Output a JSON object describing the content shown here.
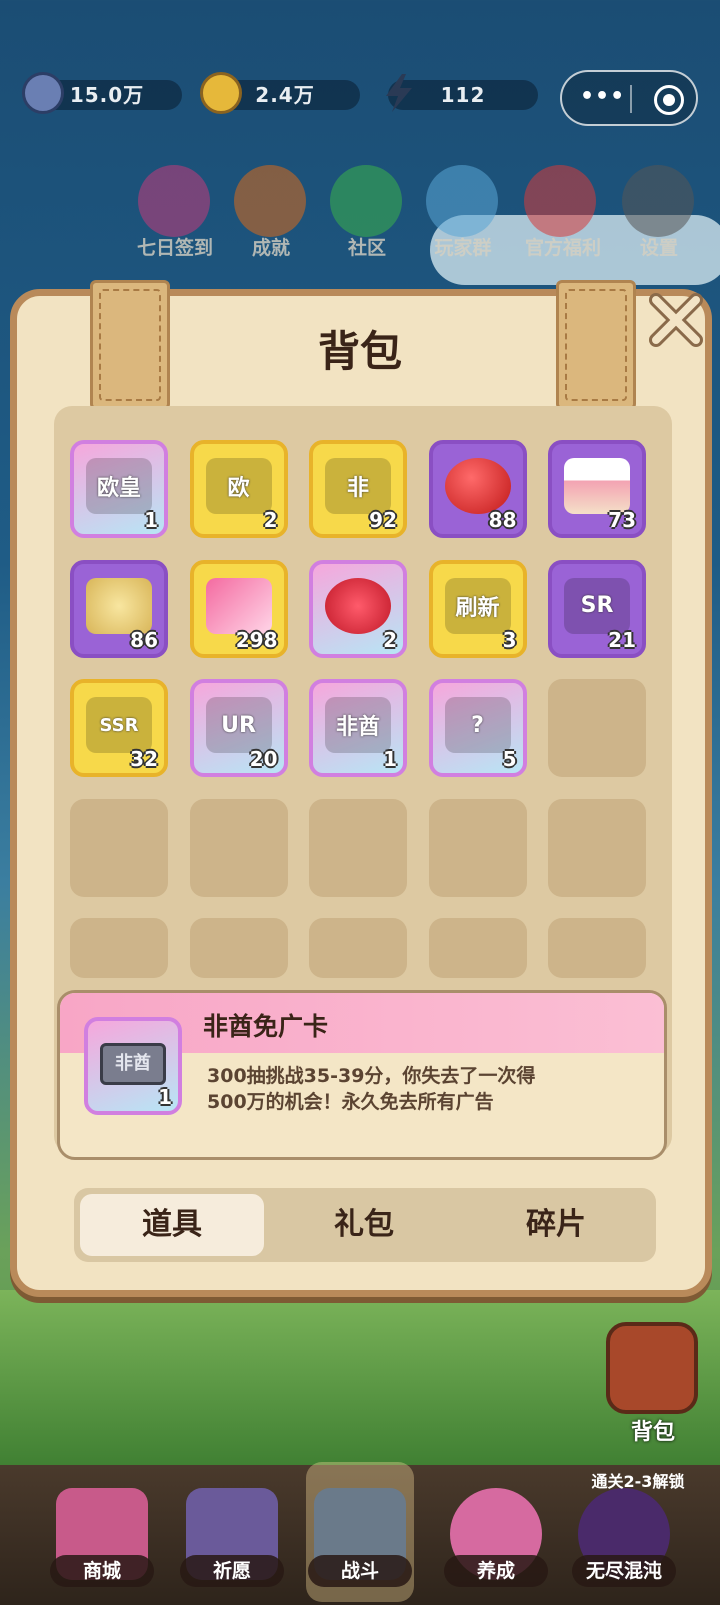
{
  "resources": [
    {
      "icon": "gem-icon",
      "value": "15.0万"
    },
    {
      "icon": "coin-icon",
      "value": "2.4万"
    },
    {
      "icon": "lightning-icon",
      "value": "112"
    }
  ],
  "top_menu": [
    "七日签到",
    "成就",
    "社区",
    "玩家群",
    "官方福利",
    "设置"
  ],
  "panel": {
    "title": "背包",
    "items": [
      {
        "name": "欧皇券",
        "label": "欧皇",
        "count": "1",
        "style": "pink"
      },
      {
        "name": "欧券",
        "label": "欧",
        "count": "2",
        "style": "gold"
      },
      {
        "name": "非酋券",
        "label": "非",
        "count": "92",
        "style": "gold"
      },
      {
        "name": "苹果",
        "label": "",
        "count": "88",
        "style": "purple"
      },
      {
        "name": "蛋糕",
        "label": "",
        "count": "73",
        "style": "purple"
      },
      {
        "name": "薯片",
        "label": "",
        "count": "86",
        "style": "purple"
      },
      {
        "name": "票",
        "label": "",
        "count": "298",
        "style": "gold"
      },
      {
        "name": "花",
        "label": "",
        "count": "2",
        "style": "pink"
      },
      {
        "name": "刷新券",
        "label": "刷新",
        "count": "3",
        "style": "gold"
      },
      {
        "name": "SR碎片",
        "label": "SR",
        "count": "21",
        "style": "purple"
      },
      {
        "name": "SSR碎片",
        "label": "SSR",
        "count": "32",
        "style": "gold"
      },
      {
        "name": "UR碎片",
        "label": "UR",
        "count": "20",
        "style": "pink"
      },
      {
        "name": "非酋免广卡",
        "label": "非酋",
        "count": "1",
        "style": "pink"
      },
      {
        "name": "神秘袋",
        "label": "?",
        "count": "5",
        "style": "pink"
      }
    ],
    "selected": {
      "name": "非酋免广卡",
      "label": "非酋",
      "count": "1",
      "description": "300抽挑战35-39分，你失去了一次得500万的机会！永久免去所有广告"
    },
    "tabs": [
      "道具",
      "礼包",
      "碎片"
    ]
  },
  "bag_button": "背包",
  "bottom_nav": [
    {
      "label": "商城"
    },
    {
      "label": "祈愿"
    },
    {
      "label": "战斗"
    },
    {
      "label": "养成"
    },
    {
      "label": "无尽混沌"
    }
  ],
  "unlock_hint": "通关2-3解锁",
  "colors": {
    "panel": "#f2e3c2",
    "border": "#b98a5a",
    "pink_header": "#f8a6c6"
  }
}
